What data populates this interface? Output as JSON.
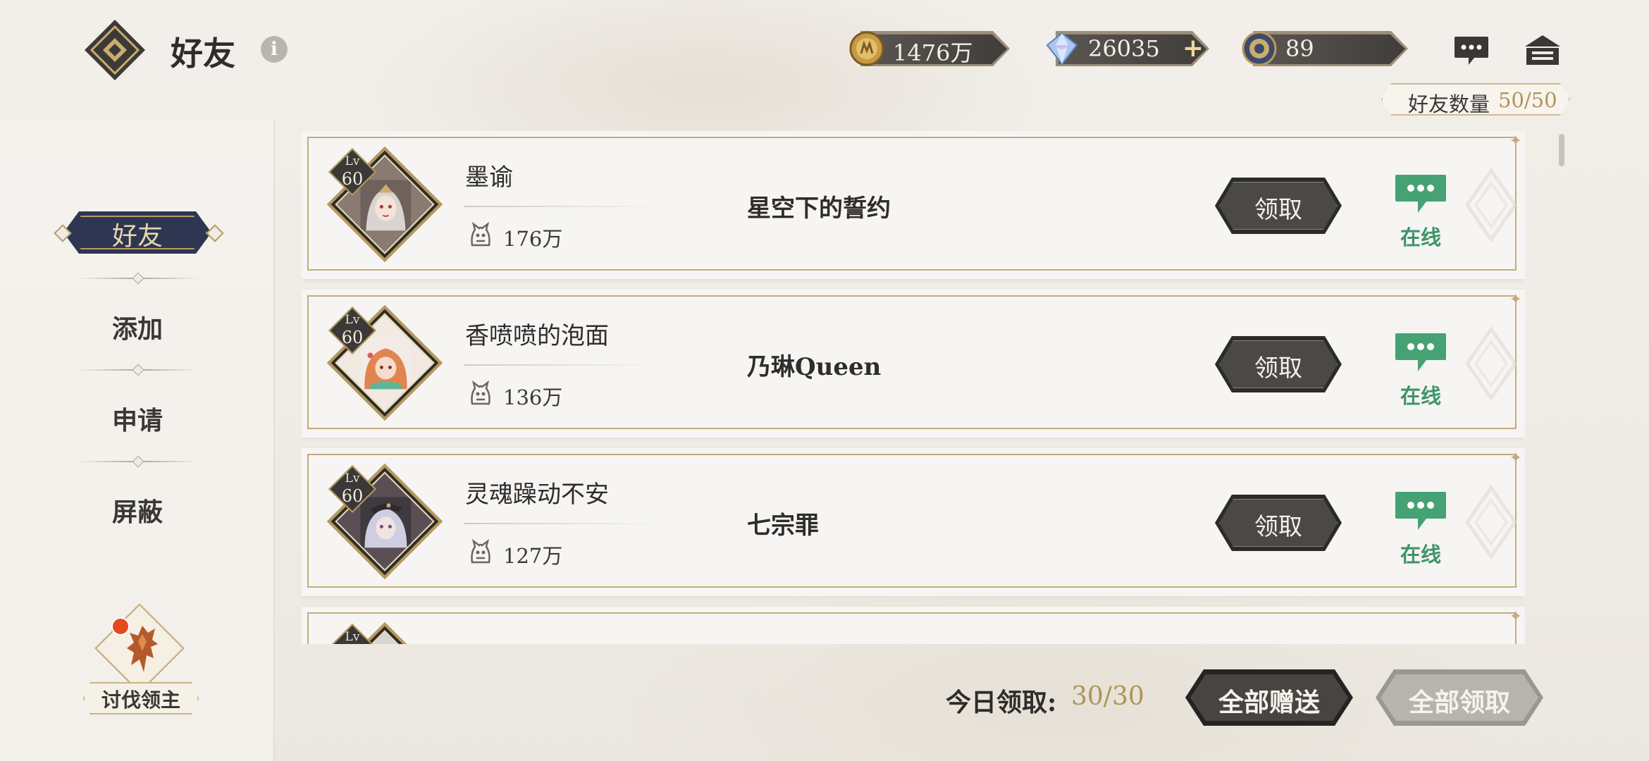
{
  "header": {
    "title": "好友",
    "info_icon": "i"
  },
  "resources": [
    {
      "icon": "gold-coin-icon",
      "value": "1476万",
      "has_plus": false
    },
    {
      "icon": "diamond-gem-icon",
      "value": "26035",
      "has_plus": true,
      "plus": "+"
    },
    {
      "icon": "token-coin-icon",
      "value": "89",
      "has_plus": false
    }
  ],
  "friend_count": {
    "label": "好友数量",
    "value": "50/50"
  },
  "sidebar": {
    "active": "好友",
    "items": [
      "添加",
      "申请",
      "屏蔽"
    ]
  },
  "boss_button": {
    "label": "讨伐领主"
  },
  "friends": [
    {
      "name": "墨谕",
      "level_prefix": "Lv",
      "level": "60",
      "power": "176万",
      "guild": "星空下的誓约",
      "claim_label": "领取",
      "status": "在线",
      "avatar_colors": [
        "#d9d4cf",
        "#8a7a72"
      ]
    },
    {
      "name": "香喷喷的泡面",
      "level_prefix": "Lv",
      "level": "60",
      "power": "136万",
      "guild": "乃琳Queen",
      "claim_label": "领取",
      "status": "在线",
      "avatar_colors": [
        "#e9a07a",
        "#5fb59a"
      ]
    },
    {
      "name": "灵魂躁动不安",
      "level_prefix": "Lv",
      "level": "60",
      "power": "127万",
      "guild": "七宗罪",
      "claim_label": "领取",
      "status": "在线",
      "avatar_colors": [
        "#cfcde0",
        "#5b4f56"
      ]
    },
    {
      "name": "",
      "level_prefix": "Lv",
      "level": "",
      "power": "",
      "guild": "",
      "claim_label": "",
      "status": "",
      "avatar_colors": [
        "#d8d6d2",
        "#a9a6a0"
      ]
    }
  ],
  "footer": {
    "today_label": "今日领取:",
    "today_value": "30/30",
    "gift_all": "全部赠送",
    "claim_all": "全部领取"
  },
  "colors": {
    "online": "#3f9469",
    "gold_text": "#b09456",
    "frame": "#c4ab7c",
    "active_tab": "#2e3652"
  }
}
